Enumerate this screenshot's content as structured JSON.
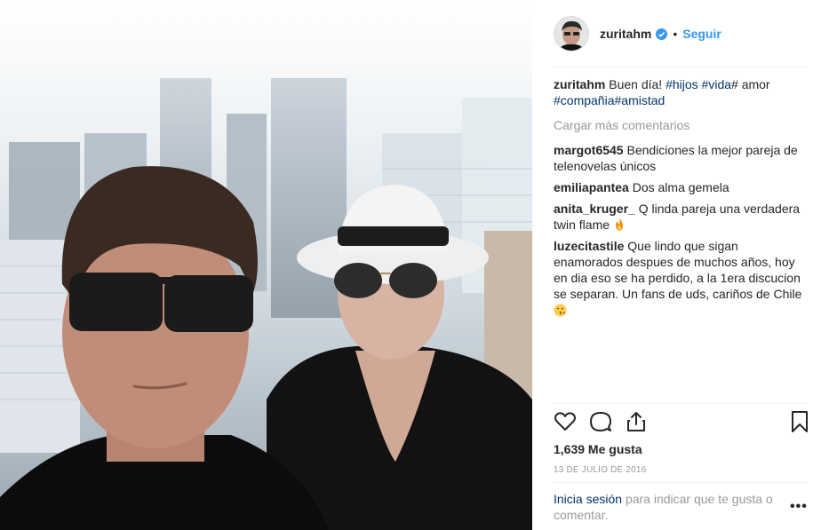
{
  "post": {
    "username": "zuritahm",
    "dot": "•",
    "follow_label": "Seguir",
    "caption": {
      "user": "zuritahm",
      "text_1": "Buen día!",
      "tag_1": "#hijos",
      "tag_2": "#vida",
      "text_2": "# amor",
      "tag_3": "#compañia",
      "tag_4": "#amistad"
    },
    "load_more": "Cargar más comentarios",
    "comments": [
      {
        "user": "margot6545",
        "text": "Bendiciones la mejor pareja de telenovelas únicos"
      },
      {
        "user": "emiliapantea",
        "text": "Dos alma gemela"
      },
      {
        "user": "anita_kruger_",
        "text": "Q linda pareja una verdadera twin flame"
      },
      {
        "user": "luzecitastile",
        "text": "Que lindo que sigan enamorados despues de muchos años, hoy en dia eso se ha perdido, a la 1era discucion se separan. Un fans de uds, cariños de Chile"
      }
    ],
    "likes": "1,639 Me gusta",
    "date": "13 DE JULIO DE 2016",
    "footer": {
      "login": "Inicia sesión",
      "text": "para indicar que te gusta o comentar."
    },
    "more_label": "•••"
  },
  "icons": {
    "verified": "verified-badge-icon",
    "like": "heart-icon",
    "comment": "comment-icon",
    "share": "share-icon",
    "save": "bookmark-icon",
    "fire": "fire-emoji",
    "kiss": "kiss-emoji"
  },
  "colors": {
    "link": "#3897f0",
    "hashtag": "#003569",
    "muted": "#999999",
    "text": "#262626"
  }
}
